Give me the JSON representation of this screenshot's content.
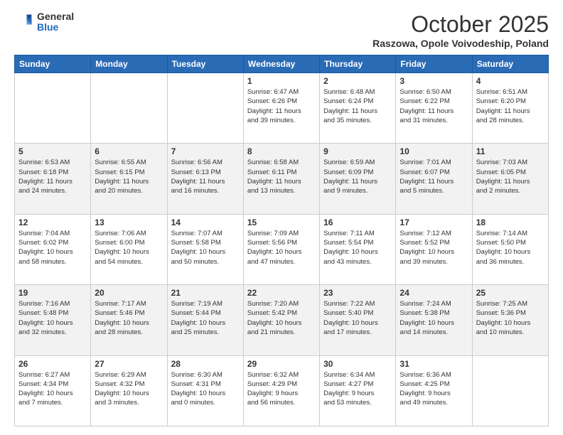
{
  "logo": {
    "general": "General",
    "blue": "Blue"
  },
  "header": {
    "month": "October 2025",
    "location": "Raszowa, Opole Voivodeship, Poland"
  },
  "weekdays": [
    "Sunday",
    "Monday",
    "Tuesday",
    "Wednesday",
    "Thursday",
    "Friday",
    "Saturday"
  ],
  "weeks": [
    [
      {
        "day": "",
        "info": ""
      },
      {
        "day": "",
        "info": ""
      },
      {
        "day": "",
        "info": ""
      },
      {
        "day": "1",
        "info": "Sunrise: 6:47 AM\nSunset: 6:26 PM\nDaylight: 11 hours\nand 39 minutes."
      },
      {
        "day": "2",
        "info": "Sunrise: 6:48 AM\nSunset: 6:24 PM\nDaylight: 11 hours\nand 35 minutes."
      },
      {
        "day": "3",
        "info": "Sunrise: 6:50 AM\nSunset: 6:22 PM\nDaylight: 11 hours\nand 31 minutes."
      },
      {
        "day": "4",
        "info": "Sunrise: 6:51 AM\nSunset: 6:20 PM\nDaylight: 11 hours\nand 28 minutes."
      }
    ],
    [
      {
        "day": "5",
        "info": "Sunrise: 6:53 AM\nSunset: 6:18 PM\nDaylight: 11 hours\nand 24 minutes."
      },
      {
        "day": "6",
        "info": "Sunrise: 6:55 AM\nSunset: 6:15 PM\nDaylight: 11 hours\nand 20 minutes."
      },
      {
        "day": "7",
        "info": "Sunrise: 6:56 AM\nSunset: 6:13 PM\nDaylight: 11 hours\nand 16 minutes."
      },
      {
        "day": "8",
        "info": "Sunrise: 6:58 AM\nSunset: 6:11 PM\nDaylight: 11 hours\nand 13 minutes."
      },
      {
        "day": "9",
        "info": "Sunrise: 6:59 AM\nSunset: 6:09 PM\nDaylight: 11 hours\nand 9 minutes."
      },
      {
        "day": "10",
        "info": "Sunrise: 7:01 AM\nSunset: 6:07 PM\nDaylight: 11 hours\nand 5 minutes."
      },
      {
        "day": "11",
        "info": "Sunrise: 7:03 AM\nSunset: 6:05 PM\nDaylight: 11 hours\nand 2 minutes."
      }
    ],
    [
      {
        "day": "12",
        "info": "Sunrise: 7:04 AM\nSunset: 6:02 PM\nDaylight: 10 hours\nand 58 minutes."
      },
      {
        "day": "13",
        "info": "Sunrise: 7:06 AM\nSunset: 6:00 PM\nDaylight: 10 hours\nand 54 minutes."
      },
      {
        "day": "14",
        "info": "Sunrise: 7:07 AM\nSunset: 5:58 PM\nDaylight: 10 hours\nand 50 minutes."
      },
      {
        "day": "15",
        "info": "Sunrise: 7:09 AM\nSunset: 5:56 PM\nDaylight: 10 hours\nand 47 minutes."
      },
      {
        "day": "16",
        "info": "Sunrise: 7:11 AM\nSunset: 5:54 PM\nDaylight: 10 hours\nand 43 minutes."
      },
      {
        "day": "17",
        "info": "Sunrise: 7:12 AM\nSunset: 5:52 PM\nDaylight: 10 hours\nand 39 minutes."
      },
      {
        "day": "18",
        "info": "Sunrise: 7:14 AM\nSunset: 5:50 PM\nDaylight: 10 hours\nand 36 minutes."
      }
    ],
    [
      {
        "day": "19",
        "info": "Sunrise: 7:16 AM\nSunset: 5:48 PM\nDaylight: 10 hours\nand 32 minutes."
      },
      {
        "day": "20",
        "info": "Sunrise: 7:17 AM\nSunset: 5:46 PM\nDaylight: 10 hours\nand 28 minutes."
      },
      {
        "day": "21",
        "info": "Sunrise: 7:19 AM\nSunset: 5:44 PM\nDaylight: 10 hours\nand 25 minutes."
      },
      {
        "day": "22",
        "info": "Sunrise: 7:20 AM\nSunset: 5:42 PM\nDaylight: 10 hours\nand 21 minutes."
      },
      {
        "day": "23",
        "info": "Sunrise: 7:22 AM\nSunset: 5:40 PM\nDaylight: 10 hours\nand 17 minutes."
      },
      {
        "day": "24",
        "info": "Sunrise: 7:24 AM\nSunset: 5:38 PM\nDaylight: 10 hours\nand 14 minutes."
      },
      {
        "day": "25",
        "info": "Sunrise: 7:25 AM\nSunset: 5:36 PM\nDaylight: 10 hours\nand 10 minutes."
      }
    ],
    [
      {
        "day": "26",
        "info": "Sunrise: 6:27 AM\nSunset: 4:34 PM\nDaylight: 10 hours\nand 7 minutes."
      },
      {
        "day": "27",
        "info": "Sunrise: 6:29 AM\nSunset: 4:32 PM\nDaylight: 10 hours\nand 3 minutes."
      },
      {
        "day": "28",
        "info": "Sunrise: 6:30 AM\nSunset: 4:31 PM\nDaylight: 10 hours\nand 0 minutes."
      },
      {
        "day": "29",
        "info": "Sunrise: 6:32 AM\nSunset: 4:29 PM\nDaylight: 9 hours\nand 56 minutes."
      },
      {
        "day": "30",
        "info": "Sunrise: 6:34 AM\nSunset: 4:27 PM\nDaylight: 9 hours\nand 53 minutes."
      },
      {
        "day": "31",
        "info": "Sunrise: 6:36 AM\nSunset: 4:25 PM\nDaylight: 9 hours\nand 49 minutes."
      },
      {
        "day": "",
        "info": ""
      }
    ]
  ]
}
